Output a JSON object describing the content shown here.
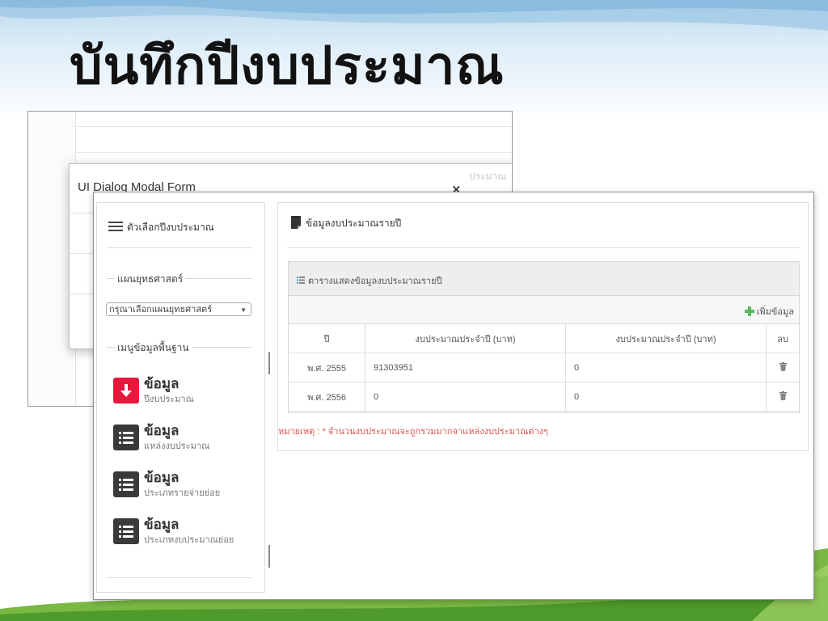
{
  "slide": {
    "title": "บันทึกปีงบประมาณ"
  },
  "bg_dialog": {
    "title": "UI Dialog Modal Form",
    "close_label": "×",
    "faded_text": "ประมาณ"
  },
  "sidebar": {
    "header": "ตัวเลือกปีงบประมาณ",
    "plan_section_label": "แผนยุทธศาสตร์",
    "plan_select": {
      "value": "กรุณาเลือกแผนยุทธศาสตร์"
    },
    "base_menu_label": "เมนูข้อมูลพื้นฐาน",
    "menu_items": [
      {
        "title": "ข้อมูล",
        "subtitle": "ปีงบประมาณ",
        "icon": "download-arrow-icon"
      },
      {
        "title": "ข้อมูล",
        "subtitle": "แหล่งงบประมาณ",
        "icon": "list-icon"
      },
      {
        "title": "ข้อมูล",
        "subtitle": "ประเภทรายจ่ายย่อย",
        "icon": "list-icon"
      },
      {
        "title": "ข้อมูล",
        "subtitle": "ประเภทงบประมาณย่อย",
        "icon": "list-icon"
      }
    ]
  },
  "content": {
    "header": "ข้อมูลงบประมาณรายปี",
    "table_caption": "ตารางแสดงข้อมูลงบประมาณรายปี",
    "add_label": "เพิ่มข้อมูล",
    "columns": [
      "ปี",
      "งบประมาณประจำปี (บาท)",
      "งบประมาณประจำปี (บาท)",
      "ลบ"
    ],
    "rows": [
      {
        "year": "พ.ศ. 2555",
        "budget": "91303951",
        "budget2": "0"
      },
      {
        "year": "พ.ศ. 2556",
        "budget": "0",
        "budget2": "0"
      }
    ],
    "note": "หมายเหตุ : * จำนวนงบประมาณจะถูกรวมมากจาแหล่งงบประมาณต่างๆ"
  },
  "colors": {
    "accent_red": "#e8173d",
    "tile_dark": "#3a3a3a",
    "note_red": "#d9534f",
    "add_green": "#5cb85c"
  }
}
